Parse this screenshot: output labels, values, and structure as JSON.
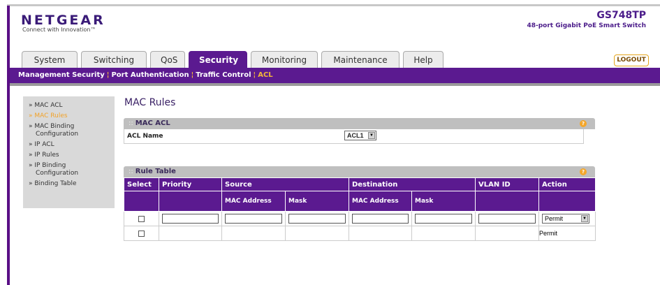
{
  "header": {
    "brand": "NETGEAR",
    "tagline": "Connect with Innovation™",
    "model": "GS748TP",
    "model_desc": "48-port Gigabit PoE Smart Switch"
  },
  "tabs": [
    {
      "label": "System"
    },
    {
      "label": "Switching"
    },
    {
      "label": "QoS"
    },
    {
      "label": "Security"
    },
    {
      "label": "Monitoring"
    },
    {
      "label": "Maintenance"
    },
    {
      "label": "Help"
    }
  ],
  "logout_label": "LOGOUT",
  "subnav": [
    "Management Security",
    "Port Authentication",
    "Traffic Control",
    "ACL"
  ],
  "sidebar": [
    {
      "label": "» MAC ACL"
    },
    {
      "label": "» MAC Rules"
    },
    {
      "label": "» MAC Binding",
      "label2": "Configuration"
    },
    {
      "label": "» IP ACL"
    },
    {
      "label": "» IP Rules"
    },
    {
      "label": "» IP Binding",
      "label2": "Configuration"
    },
    {
      "label": "» Binding Table"
    }
  ],
  "page_title": "MAC Rules",
  "mac_acl": {
    "title": "MAC ACL",
    "acl_name_label": "ACL Name",
    "acl_name_value": "ACL1"
  },
  "rule_table": {
    "title": "Rule Table",
    "headers": {
      "select": "Select",
      "priority": "Priority",
      "source": "Source",
      "destination": "Destination",
      "vlan_id": "VLAN ID",
      "action": "Action",
      "mac_address": "MAC Address",
      "mask": "Mask"
    },
    "edit_row_action": "Permit",
    "rows": [
      {
        "action": "Permit"
      }
    ]
  },
  "colors": {
    "brand_purple": "#5b1a90",
    "accent_orange": "#f2a228"
  }
}
